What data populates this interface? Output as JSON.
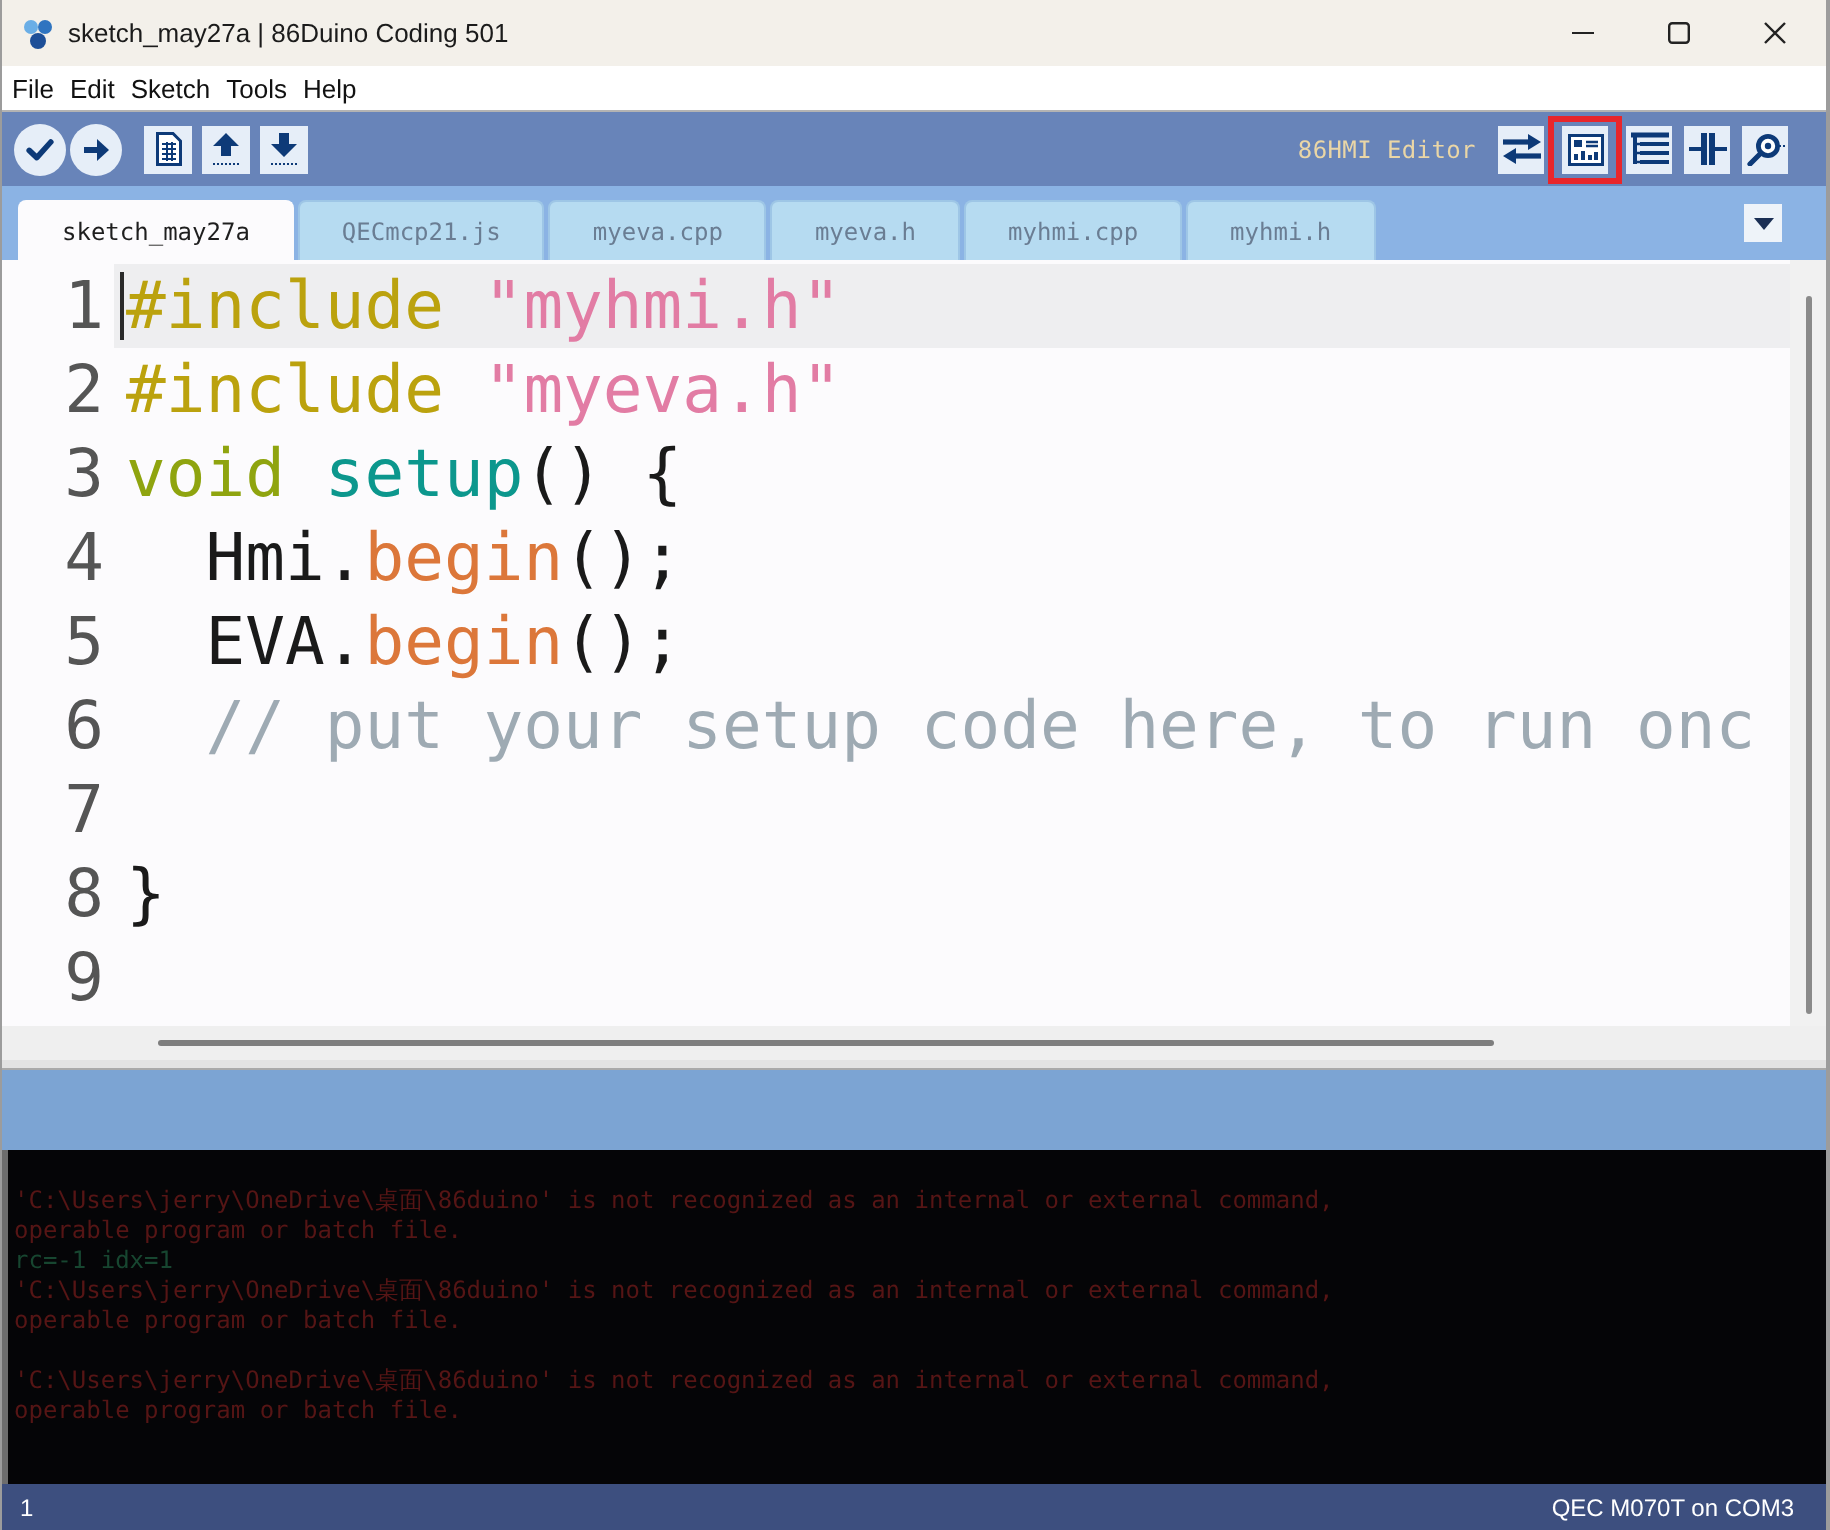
{
  "window": {
    "title": "sketch_may27a | 86Duino Coding 501"
  },
  "menu": [
    "File",
    "Edit",
    "Sketch",
    "Tools",
    "Help"
  ],
  "toolbar": {
    "buttons": [
      {
        "kind": "verify"
      },
      {
        "kind": "upload"
      },
      {
        "kind": "new"
      },
      {
        "kind": "open"
      },
      {
        "kind": "save"
      }
    ],
    "hover_label": "86HMI Editor",
    "right_buttons": [
      {
        "kind": "switch",
        "highlighted": false
      },
      {
        "kind": "hmi_editor",
        "highlighted": true
      },
      {
        "kind": "outline",
        "highlighted": false
      },
      {
        "kind": "split",
        "highlighted": false
      },
      {
        "kind": "monitor",
        "highlighted": false
      }
    ]
  },
  "tabs": [
    {
      "label": "sketch_may27a",
      "selected": true
    },
    {
      "label": "QECmcp21.js",
      "selected": false
    },
    {
      "label": "myeva.cpp",
      "selected": false
    },
    {
      "label": "myeva.h",
      "selected": false
    },
    {
      "label": "myhmi.cpp",
      "selected": false
    },
    {
      "label": "myhmi.h",
      "selected": false
    }
  ],
  "editor": {
    "lines": [
      {
        "number": "1",
        "current": true,
        "tokens": [
          {
            "kind": "directive",
            "text": "#include"
          },
          {
            "kind": "string",
            "text": " \"myhmi.h\""
          }
        ]
      },
      {
        "number": "2",
        "current": false,
        "tokens": [
          {
            "kind": "directive",
            "text": "#include"
          },
          {
            "kind": "string",
            "text": " \"myeva.h\""
          }
        ]
      },
      {
        "number": "3",
        "current": false,
        "tokens": [
          {
            "kind": "keyword",
            "text": "void"
          },
          {
            "kind": "function",
            "text": " setup"
          },
          {
            "kind": "plain",
            "text": "() {"
          }
        ]
      },
      {
        "number": "4",
        "current": false,
        "tokens": [
          {
            "kind": "plain",
            "text": "  Hmi."
          },
          {
            "kind": "method",
            "text": "begin"
          },
          {
            "kind": "plain",
            "text": "();"
          }
        ]
      },
      {
        "number": "5",
        "current": false,
        "tokens": [
          {
            "kind": "plain",
            "text": "  EVA."
          },
          {
            "kind": "method",
            "text": "begin"
          },
          {
            "kind": "plain",
            "text": "();"
          }
        ]
      },
      {
        "number": "6",
        "current": false,
        "tokens": [
          {
            "kind": "comment",
            "text": "  // put your setup code here, to run onc"
          }
        ]
      },
      {
        "number": "7",
        "current": false
      },
      {
        "number": "8",
        "current": false,
        "tokens": [
          {
            "kind": "plain",
            "text": "}"
          }
        ]
      },
      {
        "number": "9",
        "current": false
      }
    ]
  },
  "console": {
    "lines": [
      {
        "kind": "error",
        "text": "'C:\\Users\\jerry\\OneDrive\\桌面\\86duino' is not recognized as an internal or external command,"
      },
      {
        "kind": "error",
        "text": "operable program or batch file."
      },
      {
        "kind": "output",
        "text": "rc=-1 idx=1"
      },
      {
        "kind": "error",
        "text": "'C:\\Users\\jerry\\OneDrive\\桌面\\86duino' is not recognized as an internal or external command,"
      },
      {
        "kind": "error",
        "text": "operable program or batch file."
      },
      {
        "kind": "blank"
      },
      {
        "kind": "error",
        "text": "'C:\\Users\\jerry\\OneDrive\\桌面\\86duino' is not recognized as an internal or external command,"
      },
      {
        "kind": "error",
        "text": "operable program or batch file."
      }
    ]
  },
  "status_bar": {
    "line": "1",
    "board": "QEC M070T on COM3"
  }
}
